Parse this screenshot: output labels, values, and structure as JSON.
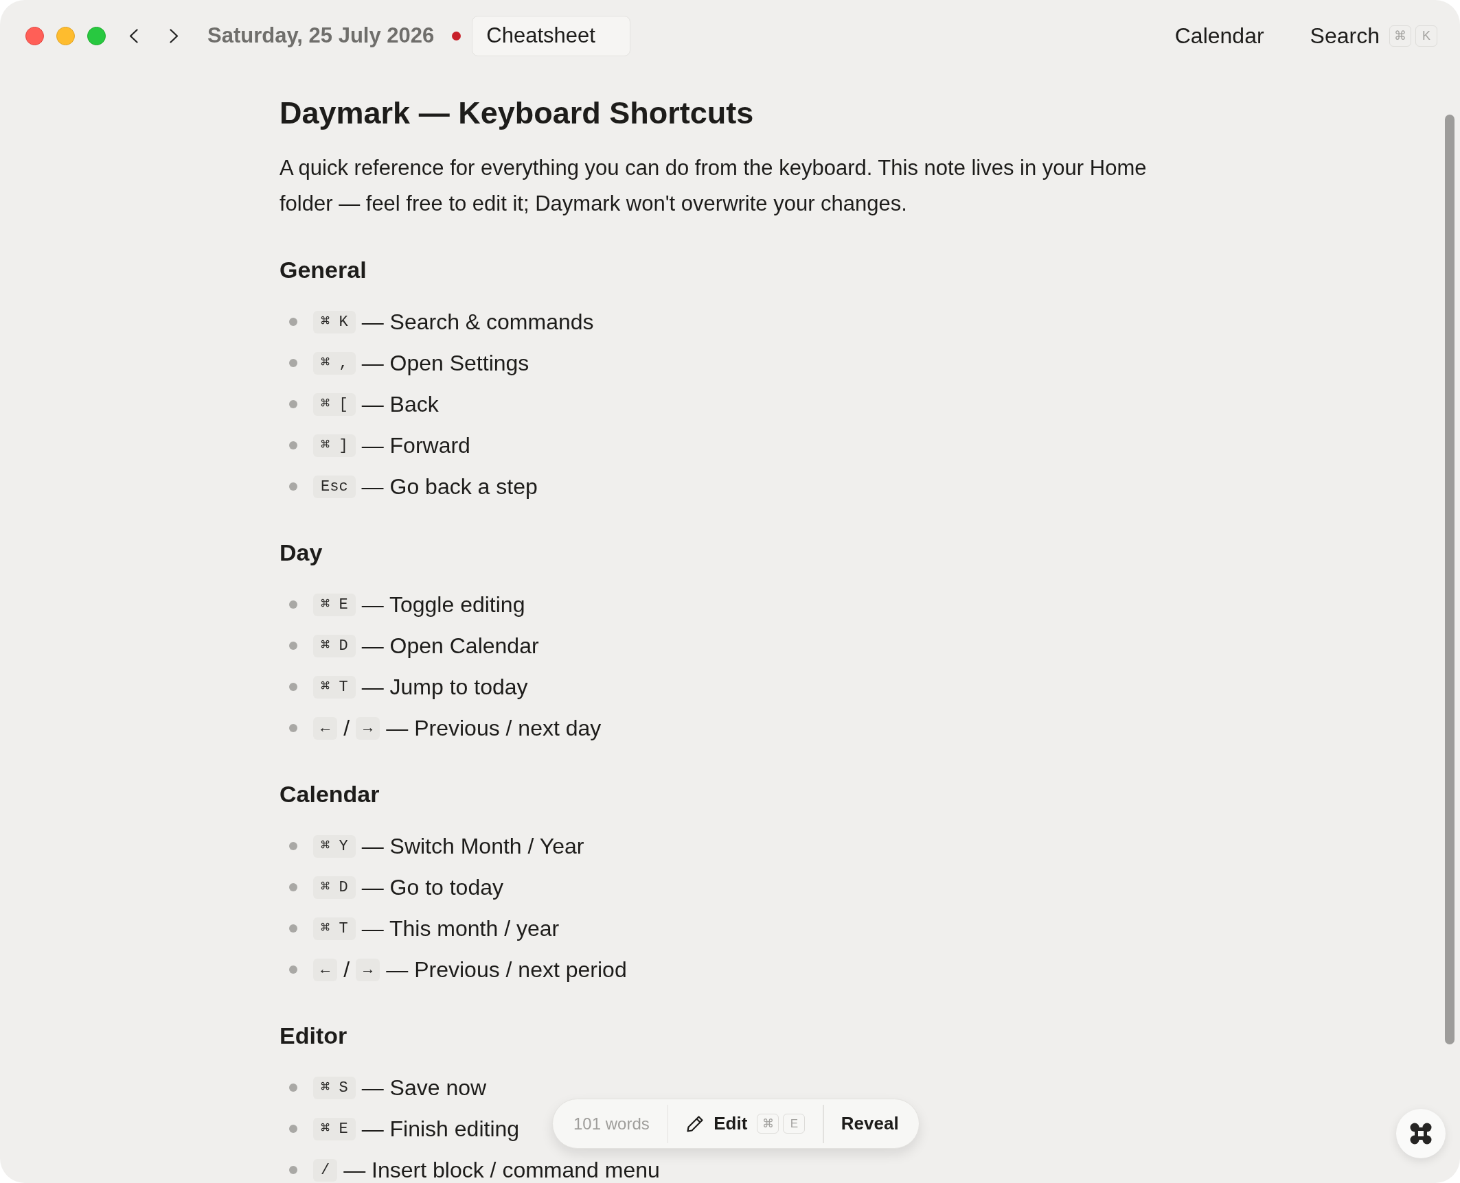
{
  "toolbar": {
    "date": "Saturday, 25 July 2026",
    "date_dot": true,
    "note_tab": "Cheatsheet",
    "links": [
      {
        "label": "Calendar"
      },
      {
        "label": "Search",
        "keys": [
          "⌘",
          "K"
        ]
      }
    ]
  },
  "document": {
    "title": "Daymark — Keyboard Shortcuts",
    "intro": "A quick reference for everything you can do from the keyboard. This note lives in your Home folder — feel free to edit it; Daymark won't overwrite your changes.",
    "sections": [
      {
        "heading": "General",
        "items": [
          {
            "shortcut": [
              {
                "kind": "key",
                "text": "⌘ K"
              }
            ],
            "text": "— Search & commands"
          },
          {
            "shortcut": [
              {
                "kind": "key",
                "text": "⌘ ,"
              }
            ],
            "text": "— Open Settings"
          },
          {
            "shortcut": [
              {
                "kind": "key",
                "text": "⌘ ["
              }
            ],
            "text": "— Back"
          },
          {
            "shortcut": [
              {
                "kind": "key",
                "text": "⌘ ]"
              }
            ],
            "text": "— Forward"
          },
          {
            "shortcut": [
              {
                "kind": "key",
                "text": "Esc"
              }
            ],
            "text": "— Go back a step"
          }
        ]
      },
      {
        "heading": "Day",
        "items": [
          {
            "shortcut": [
              {
                "kind": "key",
                "text": "⌘ E"
              }
            ],
            "text": "— Toggle editing"
          },
          {
            "shortcut": [
              {
                "kind": "key",
                "text": "⌘ D"
              }
            ],
            "text": "— Open Calendar"
          },
          {
            "shortcut": [
              {
                "kind": "key",
                "text": "⌘ T"
              }
            ],
            "text": "— Jump to today"
          },
          {
            "shortcut": [
              {
                "kind": "key",
                "text": "←"
              },
              {
                "kind": "separator",
                "text": "/"
              },
              {
                "kind": "key",
                "text": "→"
              }
            ],
            "text": "— Previous / next day"
          }
        ]
      },
      {
        "heading": "Calendar",
        "items": [
          {
            "shortcut": [
              {
                "kind": "key",
                "text": "⌘ Y"
              }
            ],
            "text": "— Switch Month / Year"
          },
          {
            "shortcut": [
              {
                "kind": "key",
                "text": "⌘ D"
              }
            ],
            "text": "— Go to today"
          },
          {
            "shortcut": [
              {
                "kind": "key",
                "text": "⌘ T"
              }
            ],
            "text": "— This month / year"
          },
          {
            "shortcut": [
              {
                "kind": "key",
                "text": "←"
              },
              {
                "kind": "separator",
                "text": "/"
              },
              {
                "kind": "key",
                "text": "→"
              }
            ],
            "text": "— Previous / next period"
          }
        ]
      },
      {
        "heading": "Editor",
        "items": [
          {
            "shortcut": [
              {
                "kind": "key",
                "text": "⌘ S"
              }
            ],
            "text": "— Save now"
          },
          {
            "shortcut": [
              {
                "kind": "key",
                "text": "⌘ E"
              }
            ],
            "text": "— Finish editing"
          },
          {
            "shortcut": [
              {
                "kind": "key",
                "text": "/"
              }
            ],
            "text": "— Insert block / command menu"
          }
        ]
      }
    ]
  },
  "status_pill": {
    "word_count": "101 words",
    "edit": {
      "label": "Edit",
      "keys": [
        "⌘",
        "E"
      ]
    },
    "reveal": "Reveal"
  }
}
